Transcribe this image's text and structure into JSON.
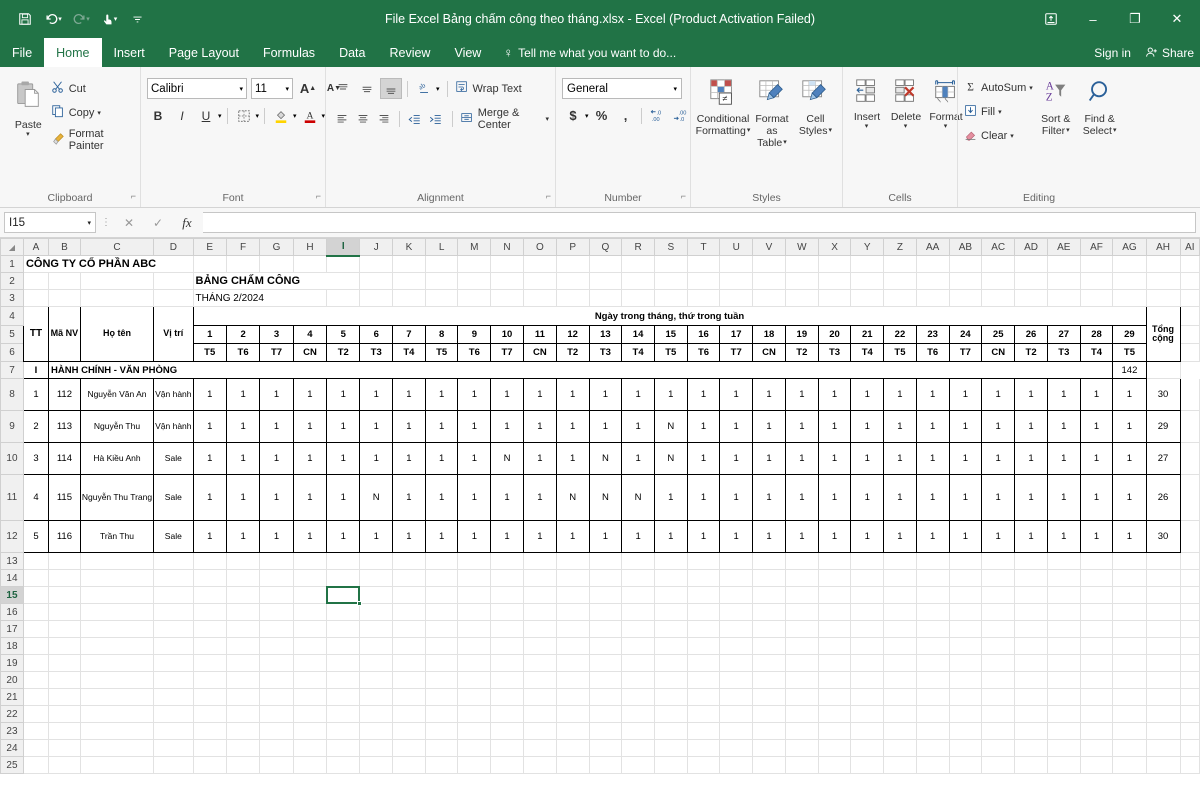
{
  "window": {
    "title": "File Excel Bảng chấm công theo tháng.xlsx - Excel (Product Activation Failed)",
    "minimize": "–",
    "restore": "❐",
    "close": "✕",
    "ribbon_display_icon": "ribbon-display-options-icon",
    "signin": "Sign in",
    "share": "Share"
  },
  "qat": {
    "save": "save-icon",
    "undo": "undo-icon",
    "redo": "redo-icon",
    "touch": "touch-mode-icon",
    "more": "customize-qat-icon"
  },
  "tabs": [
    {
      "label": "File",
      "active": false
    },
    {
      "label": "Home",
      "active": true
    },
    {
      "label": "Insert",
      "active": false
    },
    {
      "label": "Page Layout",
      "active": false
    },
    {
      "label": "Formulas",
      "active": false
    },
    {
      "label": "Data",
      "active": false
    },
    {
      "label": "Review",
      "active": false
    },
    {
      "label": "View",
      "active": false
    }
  ],
  "tellme": "Tell me what you want to do...",
  "ribbon": {
    "clipboard": {
      "label": "Clipboard",
      "paste": "Paste",
      "cut": "Cut",
      "copy": "Copy",
      "format_painter": "Format Painter"
    },
    "font": {
      "label": "Font",
      "font_name": "Calibri",
      "font_size": "11",
      "grow": "A",
      "shrink": "A",
      "bold": "B",
      "italic": "I",
      "underline": "U"
    },
    "alignment": {
      "label": "Alignment",
      "wrap_text": "Wrap Text",
      "merge_center": "Merge & Center"
    },
    "number": {
      "label": "Number",
      "format": "General",
      "currency": "$",
      "percent": "%",
      "comma": ","
    },
    "styles": {
      "label": "Styles",
      "conditional_formatting": "Conditional\nFormatting",
      "conditional_formatting_l1": "Conditional",
      "conditional_formatting_l2": "Formatting",
      "format_as_table_l1": "Format as",
      "format_as_table_l2": "Table",
      "cell_styles_l1": "Cell",
      "cell_styles_l2": "Styles"
    },
    "cells": {
      "label": "Cells",
      "insert": "Insert",
      "delete": "Delete",
      "format": "Format"
    },
    "editing": {
      "label": "Editing",
      "autosum": "AutoSum",
      "fill": "Fill",
      "clear": "Clear",
      "sort_filter_l1": "Sort &",
      "sort_filter_l2": "Filter",
      "find_select_l1": "Find &",
      "find_select_l2": "Select"
    }
  },
  "formula_bar": {
    "name_box": "I15",
    "cancel": "✕",
    "enter": "✓",
    "fx": "fx",
    "value": ""
  },
  "grid": {
    "columns": [
      "A",
      "B",
      "C",
      "D",
      "E",
      "F",
      "G",
      "H",
      "I",
      "J",
      "K",
      "L",
      "M",
      "N",
      "O",
      "P",
      "Q",
      "R",
      "S",
      "T",
      "U",
      "V",
      "W",
      "X",
      "Y",
      "Z",
      "AA",
      "AB",
      "AC",
      "AD",
      "AE",
      "AF",
      "AG",
      "AH",
      "AI"
    ],
    "selected_column": "I",
    "selected_row": 15,
    "selected_cell": "I15",
    "rows": [
      1,
      2,
      3,
      4,
      5,
      6,
      7,
      8,
      9,
      10,
      11,
      12,
      13,
      14,
      15,
      16,
      17,
      18,
      19,
      20,
      21,
      22,
      23,
      24,
      25
    ]
  },
  "sheet": {
    "company": "CÔNG TY CỔ PHẦN ABC",
    "report_title": "BẢNG CHẤM CÔNG",
    "report_month": "THÁNG 2/2024",
    "headers": {
      "tt": "TT",
      "ma_nv": "Mã NV",
      "ho_ten": "Họ tên",
      "vi_tri": "Vị trí",
      "days_banner": "Ngày trong tháng, thứ trong tuần",
      "total_l1": "Tổng",
      "total_l2": "cộng"
    },
    "days": [
      1,
      2,
      3,
      4,
      5,
      6,
      7,
      8,
      9,
      10,
      11,
      12,
      13,
      14,
      15,
      16,
      17,
      18,
      19,
      20,
      21,
      22,
      23,
      24,
      25,
      26,
      27,
      28,
      29
    ],
    "weekdays": [
      "T5",
      "T6",
      "T7",
      "CN",
      "T2",
      "T3",
      "T4",
      "T5",
      "T6",
      "T7",
      "CN",
      "T2",
      "T3",
      "T4",
      "T5",
      "T6",
      "T7",
      "CN",
      "T2",
      "T3",
      "T4",
      "T5",
      "T6",
      "T7",
      "CN",
      "T2",
      "T3",
      "T4",
      "T5"
    ],
    "section": {
      "no": "I",
      "name": "HÀNH CHÍNH - VĂN PHÒNG",
      "total": 142
    },
    "employees": [
      {
        "tt": 1,
        "ma_nv": "112",
        "ho_ten": "Nguyễn Văn An",
        "vi_tri": "Vận hành",
        "marks": [
          "1",
          "1",
          "1",
          "1",
          "1",
          "1",
          "1",
          "1",
          "1",
          "1",
          "1",
          "1",
          "1",
          "1",
          "1",
          "1",
          "1",
          "1",
          "1",
          "1",
          "1",
          "1",
          "1",
          "1",
          "1",
          "1",
          "1",
          "1",
          "1"
        ],
        "total": 30
      },
      {
        "tt": 2,
        "ma_nv": "113",
        "ho_ten": "Nguyễn Thu",
        "vi_tri": "Vận hành",
        "marks": [
          "1",
          "1",
          "1",
          "1",
          "1",
          "1",
          "1",
          "1",
          "1",
          "1",
          "1",
          "1",
          "1",
          "1",
          "N",
          "1",
          "1",
          "1",
          "1",
          "1",
          "1",
          "1",
          "1",
          "1",
          "1",
          "1",
          "1",
          "1",
          "1"
        ],
        "total": 29
      },
      {
        "tt": 3,
        "ma_nv": "114",
        "ho_ten": "Hà Kiều Anh",
        "vi_tri": "Sale",
        "marks": [
          "1",
          "1",
          "1",
          "1",
          "1",
          "1",
          "1",
          "1",
          "1",
          "N",
          "1",
          "1",
          "N",
          "1",
          "N",
          "1",
          "1",
          "1",
          "1",
          "1",
          "1",
          "1",
          "1",
          "1",
          "1",
          "1",
          "1",
          "1",
          "1"
        ],
        "total": 27
      },
      {
        "tt": 4,
        "ma_nv": "115",
        "ho_ten": "Nguyễn Thu Trang",
        "vi_tri": "Sale",
        "marks": [
          "1",
          "1",
          "1",
          "1",
          "1",
          "N",
          "1",
          "1",
          "1",
          "1",
          "1",
          "N",
          "N",
          "N",
          "1",
          "1",
          "1",
          "1",
          "1",
          "1",
          "1",
          "1",
          "1",
          "1",
          "1",
          "1",
          "1",
          "1",
          "1"
        ],
        "total": 26
      },
      {
        "tt": 5,
        "ma_nv": "116",
        "ho_ten": "Trần Thu",
        "vi_tri": "Sale",
        "marks": [
          "1",
          "1",
          "1",
          "1",
          "1",
          "1",
          "1",
          "1",
          "1",
          "1",
          "1",
          "1",
          "1",
          "1",
          "1",
          "1",
          "1",
          "1",
          "1",
          "1",
          "1",
          "1",
          "1",
          "1",
          "1",
          "1",
          "1",
          "1",
          "1"
        ],
        "total": 30
      }
    ]
  },
  "colors": {
    "excel_green": "#217346",
    "ribbon_bg": "#f7f7f7",
    "selection": "#217346"
  }
}
